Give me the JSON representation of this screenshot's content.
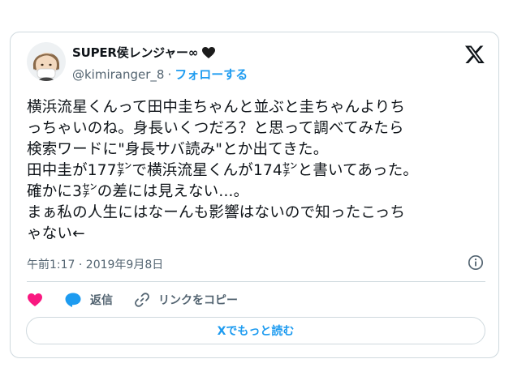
{
  "author": {
    "display_name": "SUPER侯レンジャー∞",
    "handle": "@kimiranger_8",
    "separator": "·",
    "follow_label": "フォローする"
  },
  "tweet": {
    "text": "横浜流星くんって田中圭ちゃんと並ぶと圭ちゃんよりち\nっちゃいのね。身長いくつだろ？と思って調べてみたら\n検索ワードに\"身長サバ読み\"とか出てきた。\n田中圭が177㌢で横浜流星くんが174㌢と書いてあった。\n確かに3㌢の差には見えない...。\nまぁ私の人生にはなーんも影響はないので知ったこっち\nゃない←",
    "timestamp": "午前1:17 · 2019年9月8日"
  },
  "actions": {
    "reply_label": "返信",
    "copy_link_label": "リンクをコピー"
  },
  "read_more_label": "Xでもっと読む",
  "colors": {
    "accent": "#1d9bf0",
    "like": "#f91880",
    "text": "#0f1419",
    "muted": "#536471",
    "border": "#cfd9de"
  }
}
